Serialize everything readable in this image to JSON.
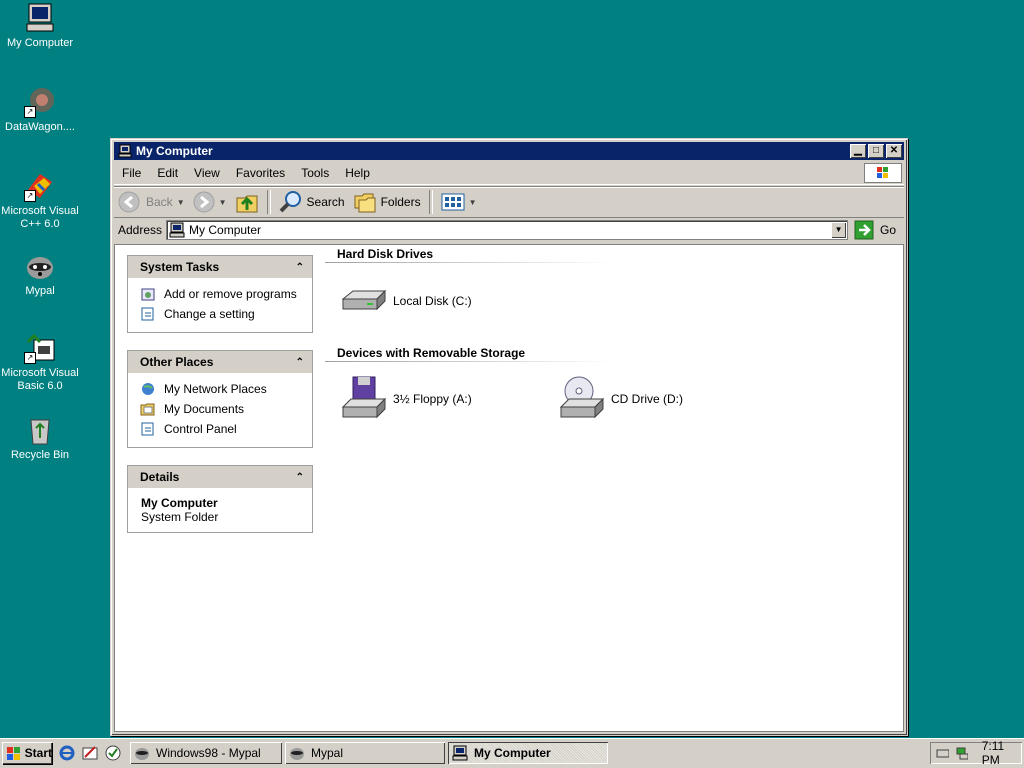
{
  "desktop": {
    "icons": [
      {
        "label": "My Computer",
        "icon": "my-computer-icon"
      },
      {
        "label": "DataWagon....",
        "icon": "datawagon-icon"
      },
      {
        "label": "Microsoft Visual C++ 6.0",
        "icon": "visual-cpp-icon"
      },
      {
        "label": "Mypal",
        "icon": "mypal-raccoon-icon"
      },
      {
        "label": "Microsoft Visual Basic 6.0",
        "icon": "visual-basic-icon"
      },
      {
        "label": "Recycle Bin",
        "icon": "recycle-bin-icon"
      }
    ]
  },
  "window": {
    "title": "My Computer",
    "menu": [
      "File",
      "Edit",
      "View",
      "Favorites",
      "Tools",
      "Help"
    ],
    "toolbar": {
      "back": "Back",
      "search": "Search",
      "folders": "Folders"
    },
    "address": {
      "label": "Address",
      "value": "My Computer",
      "go": "Go"
    },
    "tasks": {
      "system": {
        "title": "System Tasks",
        "links": [
          "Add or remove programs",
          "Change a setting"
        ]
      },
      "other": {
        "title": "Other Places",
        "links": [
          "My Network Places",
          "My Documents",
          "Control Panel"
        ]
      },
      "details": {
        "title": "Details",
        "name": "My Computer",
        "type": "System Folder"
      }
    },
    "sections": {
      "hard_disks": {
        "title": "Hard Disk Drives",
        "drives": [
          "Local Disk (C:)"
        ]
      },
      "removable": {
        "title": "Devices with Removable Storage",
        "drives": [
          "3½ Floppy (A:)",
          "CD Drive (D:)"
        ]
      }
    }
  },
  "taskbar": {
    "start": "Start",
    "tasks": [
      {
        "label": "Windows98 - Mypal",
        "active": false
      },
      {
        "label": "Mypal",
        "active": false
      },
      {
        "label": "My Computer",
        "active": true
      }
    ],
    "clock": "7:11 PM"
  },
  "colors": {
    "desktop": "#008080",
    "titlebar": "#0a246a",
    "face": "#d4d0c8"
  }
}
